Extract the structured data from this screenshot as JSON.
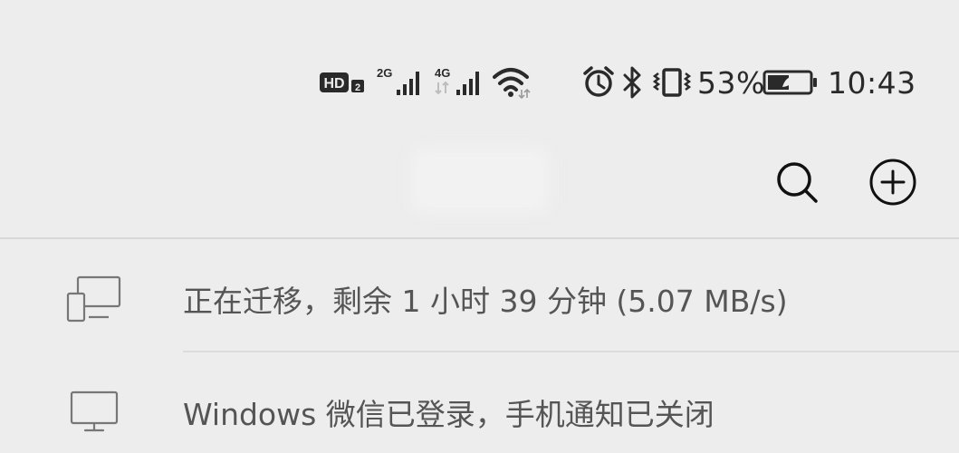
{
  "status_bar": {
    "hd_label": "HD",
    "sim1_badge": "2",
    "sim1_net": "2G",
    "sim2_net": "4G",
    "battery_percent": "53%",
    "battery_level": 0.53,
    "time": "10:43",
    "icons": [
      "hd-icon",
      "signal-icon",
      "signal-icon",
      "wifi-icon",
      "alarm-icon",
      "bluetooth-icon",
      "vibrate-icon",
      "battery-icon"
    ]
  },
  "header": {
    "title": "",
    "actions": [
      {
        "name": "search-icon"
      },
      {
        "name": "add-circle-icon"
      }
    ]
  },
  "notices": [
    {
      "icon": "devices-migrate-icon",
      "text": "正在迁移，剩余 1 小时 39 分钟 (5.07 MB/s)"
    },
    {
      "icon": "monitor-icon",
      "text": "Windows 微信已登录，手机通知已关闭"
    }
  ],
  "colors": {
    "background": "#ededed",
    "divider": "#d8d8d8",
    "notice_text": "#555555",
    "icon_gray": "#777777"
  }
}
